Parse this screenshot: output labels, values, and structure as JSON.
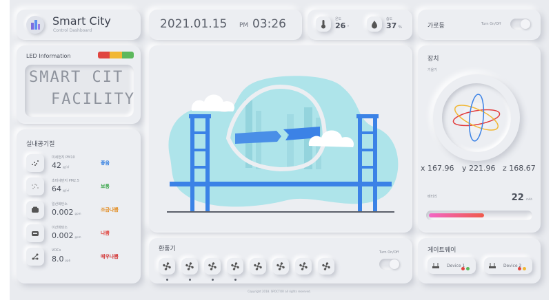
{
  "header": {
    "title": "Smart City",
    "subtitle": "Control Dashboard",
    "date": "2021.01.15",
    "ampm": "PM",
    "time": "03:26"
  },
  "weather": {
    "temp_label": "온도",
    "temp_value": "26",
    "temp_unit": "°",
    "humid_label": "습도",
    "humid_value": "37",
    "humid_unit": "%"
  },
  "streetlight": {
    "title": "가로등",
    "toggle_label": "Turn On/Off"
  },
  "led": {
    "title": "LED Information",
    "line1": "SMART CIT",
    "line2": "FACILITY",
    "colors": [
      "#e0453f",
      "#f1b733",
      "#5cb85c"
    ]
  },
  "air": {
    "title": "실내공기질",
    "rows": [
      {
        "icon": "dust-icon",
        "name": "미세먼지 PM10",
        "value": "42",
        "unit": "㎍/㎥",
        "status": "좋음",
        "color": "#2f7de1"
      },
      {
        "icon": "fine-dust-icon",
        "name": "초미세먼지 PM2.5",
        "value": "64",
        "unit": "㎍/㎥",
        "status": "보통",
        "color": "#3aa54a"
      },
      {
        "icon": "co-icon",
        "name": "일산화탄소",
        "value": "0.002",
        "unit": "ppm",
        "status": "조금나쁨",
        "color": "#e28a1d"
      },
      {
        "icon": "co2-icon",
        "name": "이산화탄소",
        "value": "0.002",
        "unit": "ppm",
        "status": "나쁨",
        "color": "#e0453f"
      },
      {
        "icon": "voc-icon",
        "name": "VOCs",
        "value": "8.0",
        "unit": "ppb",
        "status": "매우나쁨",
        "color": "#d12f2f"
      }
    ]
  },
  "device": {
    "title": "장치",
    "tilt_label": "기울기",
    "x": "x 167.96",
    "y": "y 221.96",
    "z": "z 168.67",
    "battery_label": "배터리",
    "battery_value": "22",
    "battery_unit": "mAh",
    "battery_fraction": 0.55
  },
  "ventilator": {
    "title": "환풍기",
    "toggle_label": "Turn On/Off",
    "fans": [
      {
        "on": true
      },
      {
        "on": true
      },
      {
        "on": true
      },
      {
        "on": true
      },
      {
        "on": false
      },
      {
        "on": false
      },
      {
        "on": false
      },
      {
        "on": false
      }
    ]
  },
  "gateway": {
    "title": "게이트웨이",
    "devices": [
      {
        "label": "Device 1",
        "dots": [
          "#e0453f",
          "#5cb85c"
        ]
      },
      {
        "label": "Device 2",
        "dots": [
          "#e0453f",
          "#f1b733"
        ]
      }
    ]
  },
  "footer": {
    "copyright": "Copyright 2018. SPOCTOR all rights reserved."
  },
  "colors": {
    "accent": "#3b82e6",
    "battery_gradient_start": "#f266c5",
    "battery_gradient_end": "#f05a4b"
  }
}
